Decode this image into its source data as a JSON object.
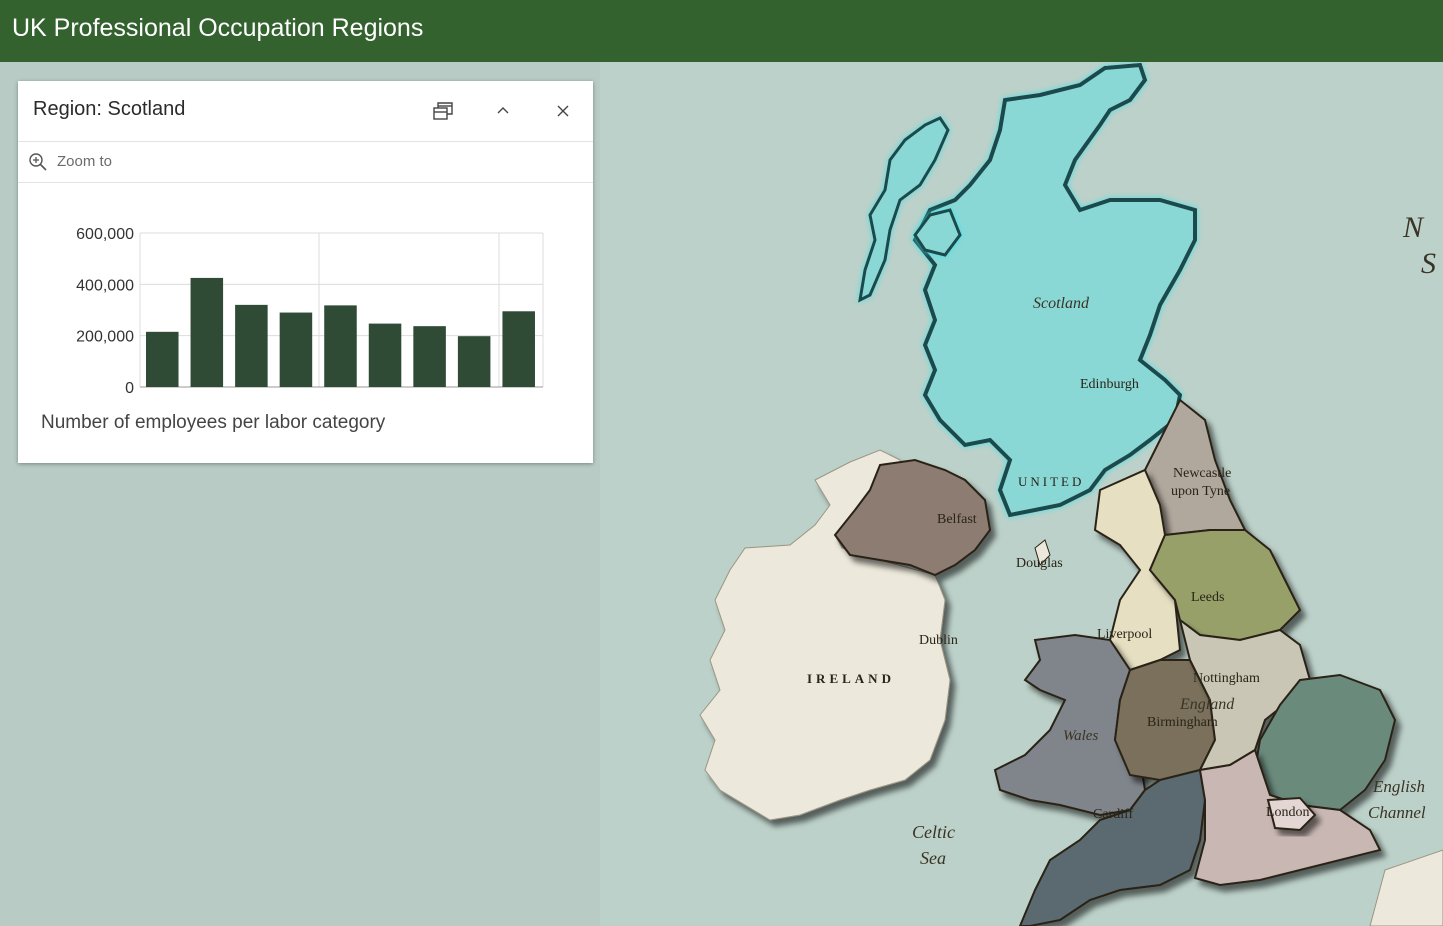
{
  "app": {
    "title": "UK Professional Occupation Regions"
  },
  "popup": {
    "title": "Region: Scotland",
    "zoom_label": "Zoom to",
    "icons": {
      "dock": "dock-icon",
      "collapse": "chevron-up-icon",
      "close": "close-icon",
      "zoom": "zoom-in-icon"
    }
  },
  "chart_data": {
    "type": "bar",
    "title": "",
    "caption": "Number of employees per labor category",
    "categories": [
      "",
      "",
      "",
      "",
      "",
      "",
      "",
      "",
      ""
    ],
    "values": [
      215000,
      425000,
      320000,
      290000,
      318000,
      247000,
      237000,
      198000,
      295000
    ],
    "ylim": [
      0,
      600000
    ],
    "yticks": [
      "600,000",
      "400,000",
      "200,000",
      "0"
    ],
    "ytick_values": [
      600000,
      400000,
      200000,
      0
    ],
    "grid": true,
    "bar_color": "#2f4a35"
  },
  "map": {
    "highlight_color": "#3fe0e6",
    "places": {
      "scotland": "Scotland",
      "edinburgh": "Edinburgh",
      "united": "UNITED",
      "newcastle_1": "Newcastle",
      "newcastle_2": "upon Tyne",
      "belfast": "Belfast",
      "douglas": "Douglas",
      "leeds": "Leeds",
      "liverpool": "Liverpool",
      "dublin": "Dublin",
      "ireland": "IRELAND",
      "nottingham": "Nottingham",
      "england": "England",
      "birmingham": "Birmingham",
      "wales": "Wales",
      "cardiff": "Cardiff",
      "london": "London",
      "celtic_1": "Celtic",
      "celtic_2": "Sea",
      "channel_1": "English",
      "channel_2": "Channel",
      "north_1": "N",
      "north_2": "S"
    }
  }
}
